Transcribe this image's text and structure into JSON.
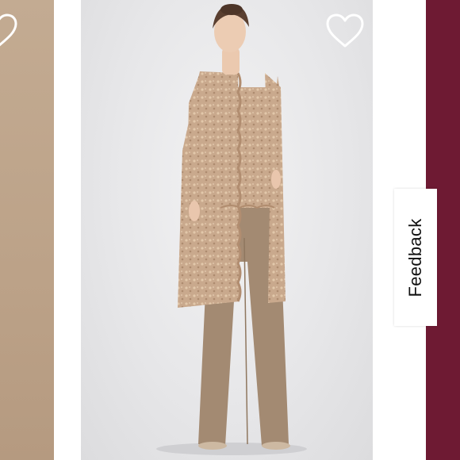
{
  "feedback": {
    "label": "Feedback"
  },
  "colors": {
    "left_card": "#bfa68c",
    "main_card_bg": "#e9e9eb",
    "right_card": "#6e1a33",
    "heart_outline": "#ffffff",
    "garment_lace": "#c7a589",
    "pants": "#a38a72"
  },
  "icons": {
    "favorite_left": "heart-outline-icon",
    "favorite_main": "heart-outline-icon"
  }
}
